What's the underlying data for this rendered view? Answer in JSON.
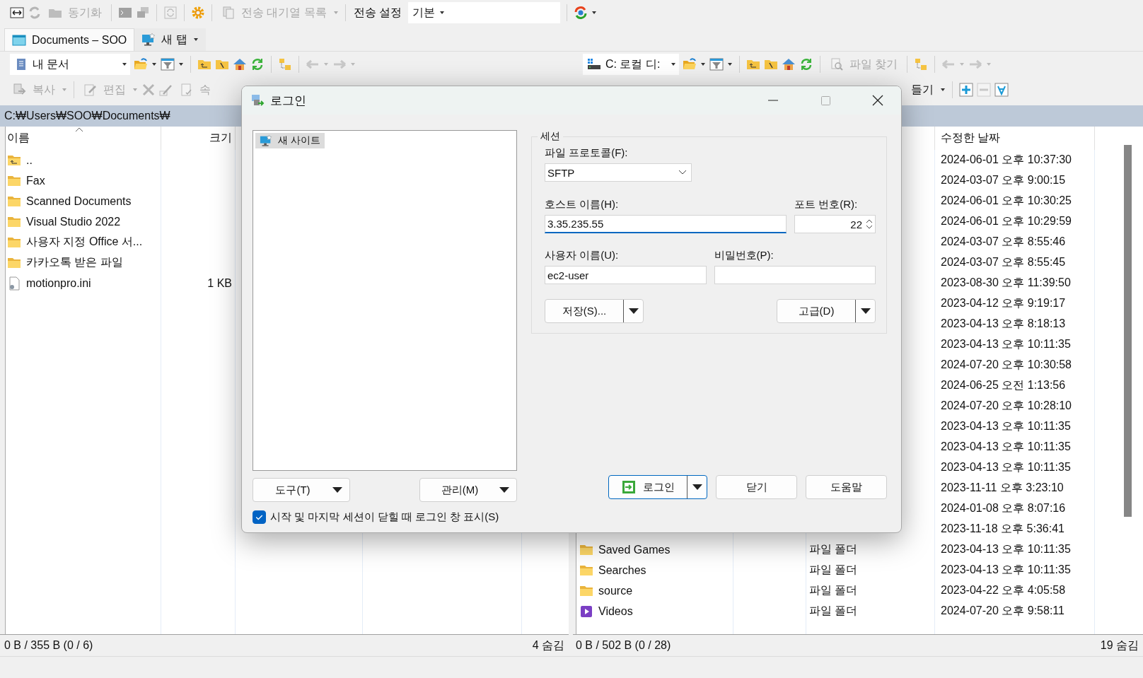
{
  "main_toolbar": {
    "synchronize": {
      "label": "동기화",
      "disabled": true
    },
    "queue": {
      "label": "전송 대기열 목록",
      "disabled": true
    },
    "transfer_settings_label": "전송 설정",
    "transfer_settings_value": "기본"
  },
  "tabs": [
    {
      "label": "Documents – SOO",
      "selected": true
    },
    {
      "label": "새 탭",
      "selected": false
    }
  ],
  "left_panel": {
    "location": "내 문서",
    "actions": [
      {
        "label": "복사",
        "disabled": true
      },
      {
        "label": "편집",
        "disabled": true
      },
      {
        "label": "속",
        "disabled": true
      }
    ],
    "path": "C:₩Users₩SOO₩Documents₩",
    "columns": [
      "이름",
      "크기"
    ],
    "rows": [
      {
        "kind": "parent",
        "name": ".."
      },
      {
        "kind": "folder",
        "name": "Fax"
      },
      {
        "kind": "folder",
        "name": "Scanned Documents"
      },
      {
        "kind": "folder",
        "name": "Visual Studio 2022"
      },
      {
        "kind": "folder",
        "name": "사용자 지정 Office 서..."
      },
      {
        "kind": "folder",
        "name": "카카오톡 받은 파일"
      },
      {
        "kind": "file",
        "name": "motionpro.ini",
        "size": "1 KB"
      }
    ],
    "status": "0 B / 355 B (0 / 6)",
    "hidden_count": "4 숨김"
  },
  "right_panel": {
    "location": "C: 로컬 디:",
    "find": {
      "label": "파일 찾기",
      "disabled": true
    },
    "new_label": "들기",
    "date_column": "수정한 날짜",
    "rows": [
      {
        "date": "2024-06-01 오후 10:37:30"
      },
      {
        "date": "2024-03-07 오후 9:00:15"
      },
      {
        "date": "2024-06-01 오후 10:30:25"
      },
      {
        "date": "2024-06-01 오후 10:29:59"
      },
      {
        "date": "2024-03-07 오후 8:55:46"
      },
      {
        "date": "2024-03-07 오후 8:55:45"
      },
      {
        "date": "2023-08-30 오후 11:39:50"
      },
      {
        "date": "2023-04-12 오후 9:19:17"
      },
      {
        "date": "2023-04-13 오후 8:18:13"
      },
      {
        "date": "2023-04-13 오후 10:11:35"
      },
      {
        "date": "2024-07-20 오후 10:30:58"
      },
      {
        "date": "2024-06-25 오전 1:13:56"
      },
      {
        "date": "2024-07-20 오후 10:28:10"
      },
      {
        "date": "2023-04-13 오후 10:11:35"
      },
      {
        "date": "2023-04-13 오후 10:11:35"
      },
      {
        "date": "2023-04-13 오후 10:11:35"
      },
      {
        "date": "2023-11-11 오후 3:23:10"
      },
      {
        "date": "2024-01-08 오후 8:07:16"
      },
      {
        "date": "2023-11-18 오후 5:36:41"
      },
      {
        "kind": "folder",
        "name": "Saved Games",
        "type": "파일 폴더",
        "date": "2023-04-13 오후 10:11:35"
      },
      {
        "kind": "folder",
        "name": "Searches",
        "type": "파일 폴더",
        "date": "2023-04-13 오후 10:11:35"
      },
      {
        "kind": "folder",
        "name": "source",
        "type": "파일 폴더",
        "date": "2023-04-22 오후 4:05:58"
      },
      {
        "kind": "video",
        "name": "Videos",
        "type": "파일 폴더",
        "date": "2024-07-20 오후 9:58:11"
      }
    ],
    "status": "0 B / 502 B (0 / 28)",
    "hidden_count": "19 숨김"
  },
  "dialog": {
    "title": "로그인",
    "sites": [
      {
        "label": "새 사이트",
        "selected": true
      }
    ],
    "tools_button": "도구(T)",
    "manage_button": "관리(M)",
    "show_on_close": {
      "label": "시작 및 마지막 세션이 닫힐 때 로그인 창 표시(S)",
      "checked": true
    },
    "session": {
      "legend": "세션",
      "protocol_label": "파일 프로토콜(F):",
      "protocol": "SFTP",
      "host_label": "호스트 이름(H):",
      "host": "3.35.235.55",
      "port_label": "포트 번호(R):",
      "port": "22",
      "user_label": "사용자 이름(U):",
      "user": "ec2-user",
      "password_label": "비밀번호(P):",
      "save_button": "저장(S)...",
      "advanced_button": "고급(D)"
    },
    "buttons": [
      {
        "kind": "split",
        "label": "로그인"
      },
      {
        "kind": "plain",
        "label": "닫기"
      },
      {
        "kind": "plain",
        "label": "도움말"
      }
    ]
  }
}
